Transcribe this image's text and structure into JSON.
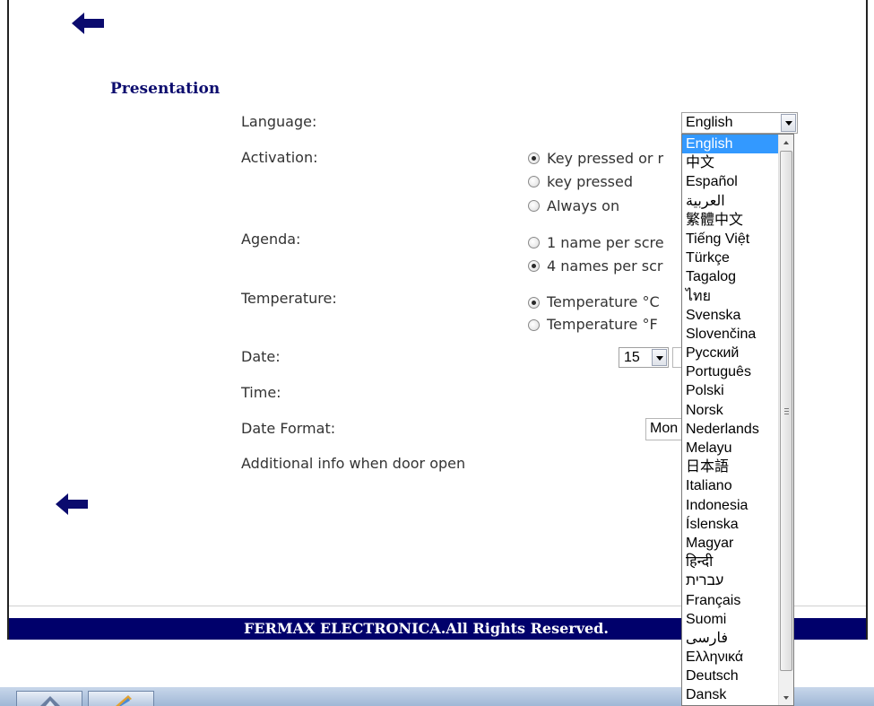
{
  "section": {
    "title": "Presentation"
  },
  "labels": {
    "language": "Language:",
    "activation": "Activation:",
    "agenda": "Agenda:",
    "temperature": "Temperature:",
    "date": "Date:",
    "time": "Time:",
    "date_format": "Date Format:",
    "additional_info": "Additional info when door open"
  },
  "language_select": {
    "value": "English"
  },
  "activation_options": [
    "Key pressed or r",
    "key pressed",
    "Always on"
  ],
  "activation_selected_index": 0,
  "agenda_options": [
    "1 name per scre",
    "4 names per scr"
  ],
  "agenda_selected_index": 1,
  "temperature_options": [
    "Temperature °C",
    "Temperature °F"
  ],
  "temperature_selected_index": 0,
  "date_select": {
    "day": "15"
  },
  "date_format_value": "Mon",
  "dropdown": {
    "selected": "English",
    "options": [
      "English",
      "中文",
      "Español",
      "العربية",
      "繁體中文",
      "Tiếng Việt",
      "Türkçe",
      "Tagalog",
      "ไทย",
      "Svenska",
      "Slovenčina",
      "Русский",
      "Português",
      "Polski",
      "Norsk",
      "Nederlands",
      "Melayu",
      "日本語",
      "Italiano",
      "Indonesia",
      "Íslenska",
      "Magyar",
      "हिन्दी",
      "עברית",
      "Français",
      "Suomi",
      "فارسی",
      "Ελληνικά",
      "Deutsch",
      "Dansk"
    ]
  },
  "footer": {
    "text": "FERMAX ELECTRONICA.All Rights Reserved."
  },
  "colors": {
    "accent": "#00006b",
    "title": "#0c0c6e",
    "highlight": "#3399ff"
  }
}
